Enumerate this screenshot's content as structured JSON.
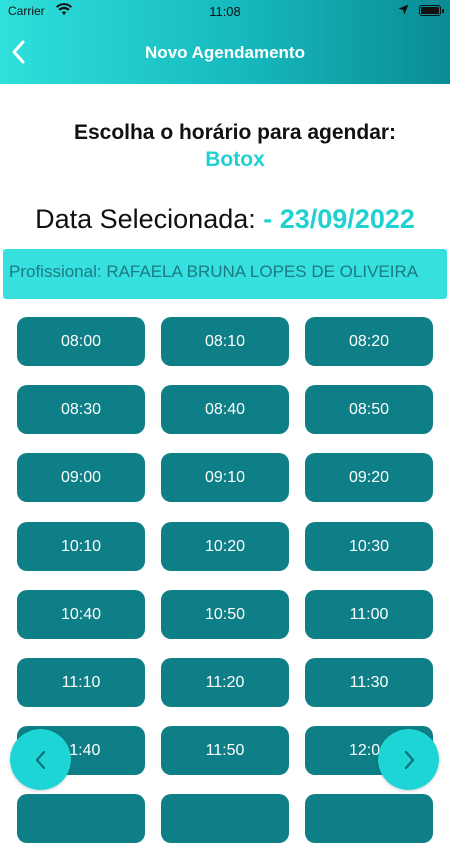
{
  "status_bar": {
    "carrier": "Carrier",
    "time": "11:08"
  },
  "nav": {
    "title": "Novo Agendamento"
  },
  "heading": {
    "choose": "Escolha o horário para agendar:",
    "service": "Botox"
  },
  "date": {
    "label": "Data Selecionada:",
    "value": " - 23/09/2022"
  },
  "professional": {
    "text": "Profissional: RAFAELA BRUNA LOPES DE OLIVEIRA"
  },
  "time_slots": [
    "08:00",
    "08:10",
    "08:20",
    "08:30",
    "08:40",
    "08:50",
    "09:00",
    "09:10",
    "09:20",
    "10:10",
    "10:20",
    "10:30",
    "10:40",
    "10:50",
    "11:00",
    "11:10",
    "11:20",
    "11:30",
    "11:40",
    "11:50",
    "12:00"
  ],
  "colors": {
    "accent": "#1fd1d1",
    "slot": "#0e7f86",
    "header_start": "#2ee0dc",
    "header_end": "#0a8b94"
  },
  "icons": {
    "back": "chevron-left-icon",
    "prev": "chevron-left-icon",
    "next": "chevron-right-icon",
    "wifi": "wifi-icon",
    "location": "location-arrow-icon",
    "battery": "battery-icon"
  }
}
